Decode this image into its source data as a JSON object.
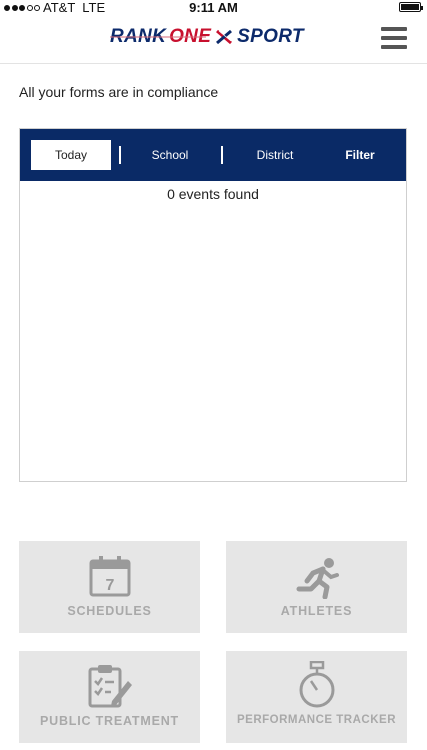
{
  "status_bar": {
    "carrier": "AT&T",
    "network": "LTE",
    "time": "9:11 AM"
  },
  "header": {
    "logo_rank": "RANK",
    "logo_one": "ONE",
    "logo_sport": "SPORT",
    "menu_icon": "hamburger-menu-icon"
  },
  "compliance_message": "All your forms are in compliance",
  "events": {
    "tabs": {
      "today": "Today",
      "school": "School",
      "district": "District",
      "filter": "Filter"
    },
    "empty_message": "0 events found"
  },
  "tiles": {
    "schedules": {
      "label": "SCHEDULES",
      "icon": "calendar-icon",
      "calendar_day": "7"
    },
    "athletes": {
      "label": "ATHLETES",
      "icon": "running-person-icon"
    },
    "treatment": {
      "label": "PUBLIC TREATMENT",
      "icon": "clipboard-icon"
    },
    "performance": {
      "label": "PERFORMANCE TRACKER",
      "icon": "stopwatch-icon"
    }
  },
  "colors": {
    "brand_navy": "#0a2a66",
    "brand_red": "#c8102e",
    "tile_background": "#e6e6e6",
    "tile_text": "#a9a9a9"
  }
}
